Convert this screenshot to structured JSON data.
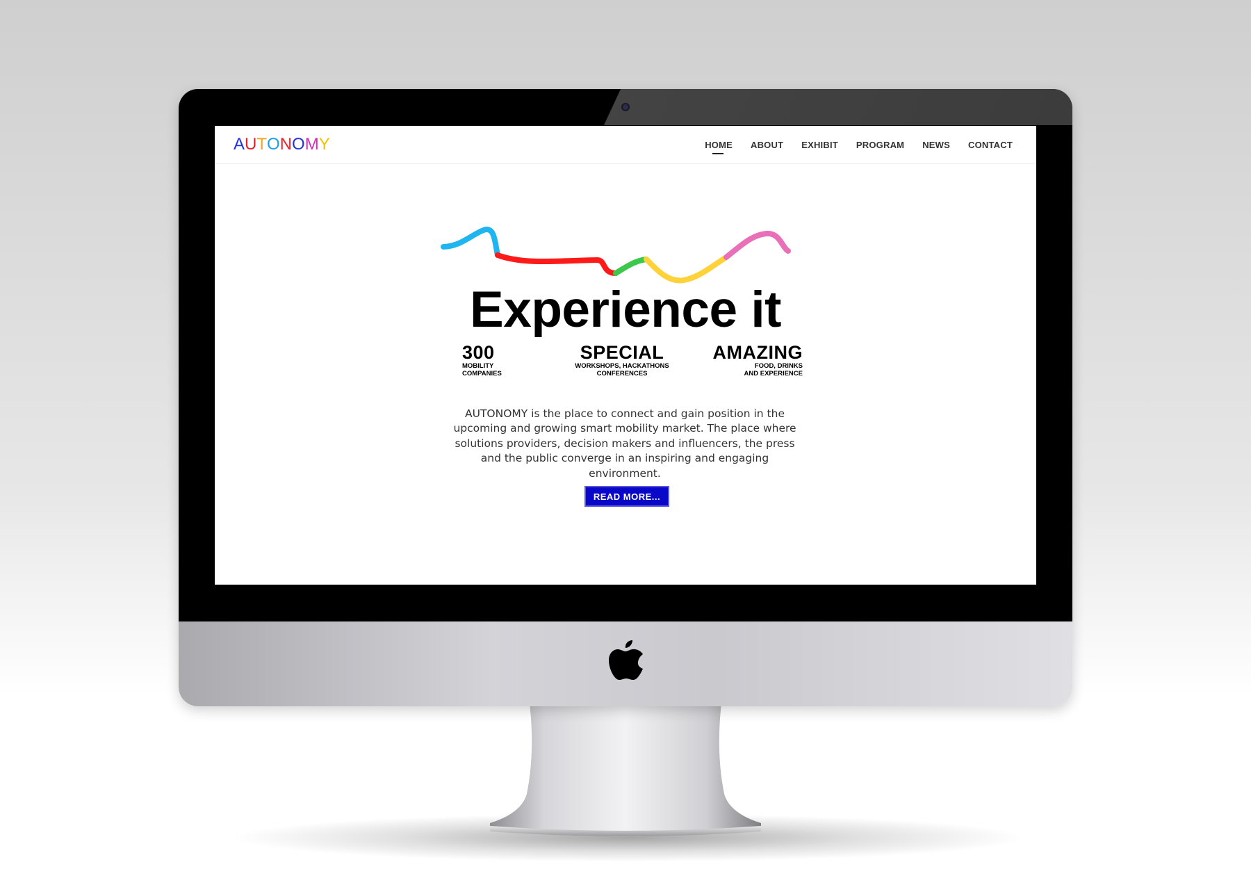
{
  "site": {
    "brand": {
      "text": "AUTONOMY",
      "letter_colors": [
        "#2233dd",
        "#e8202a",
        "#f5a623",
        "#1aa0e8",
        "#e8202a",
        "#2233dd",
        "#d82bb8",
        "#f2c200"
      ]
    },
    "nav": [
      {
        "label": "HOME",
        "active": true
      },
      {
        "label": "ABOUT",
        "active": false
      },
      {
        "label": "EXHIBIT",
        "active": false
      },
      {
        "label": "PROGRAM",
        "active": false
      },
      {
        "label": "NEWS",
        "active": false
      },
      {
        "label": "CONTACT",
        "active": false
      }
    ],
    "hero": {
      "headline": "Experience it",
      "squiggle_colors": [
        "#1fb6f0",
        "#ff1a1a",
        "#3cc84a",
        "#ffd23a",
        "#e86fb8"
      ],
      "stats": [
        {
          "big": "300",
          "lines": [
            "MOBILITY",
            "COMPANIES"
          ]
        },
        {
          "big": "SPECIAL",
          "lines": [
            "WORKSHOPS, HACKATHONS",
            "CONFERENCES"
          ]
        },
        {
          "big": "AMAZING",
          "lines": [
            "FOOD, DRINKS",
            "AND EXPERIENCE"
          ]
        }
      ],
      "description": "AUTONOMY is the place to connect and gain position in the upcoming and growing smart mobility market. The place where solutions providers, decision makers and influencers, the press and the public converge in an inspiring and engaging environment.",
      "cta_label": "READ MORE..."
    }
  },
  "device": {
    "logo_icon": "apple-logo-icon",
    "bezel_color": "#000000",
    "chin_color": "#c8c8cc",
    "accent_blue": "#0a08c8"
  }
}
